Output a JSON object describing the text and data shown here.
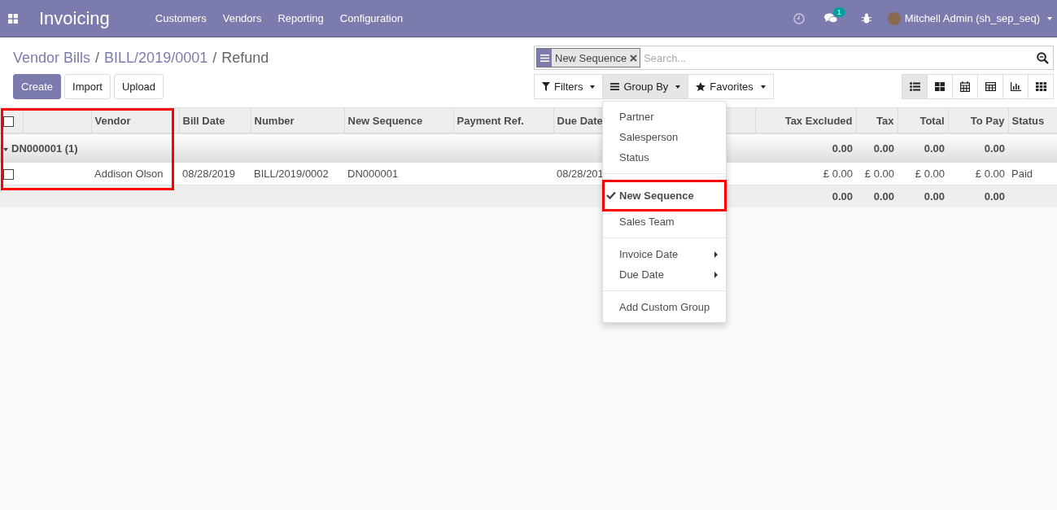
{
  "navbar": {
    "app_title": "Invoicing",
    "menu": [
      "Customers",
      "Vendors",
      "Reporting",
      "Configuration"
    ],
    "chat_badge": "1",
    "user": "Mitchell Admin (sh_sep_seq)"
  },
  "breadcrumb": [
    {
      "label": "Vendor Bills",
      "kind": "link"
    },
    {
      "separator": "/",
      "label": "BILL/2019/0001",
      "kind": "link"
    },
    {
      "separator": "/",
      "label": "Refund",
      "kind": "current"
    }
  ],
  "buttons": [
    {
      "label": "Create",
      "kind": "primary"
    },
    {
      "label": "Import",
      "kind": "default"
    },
    {
      "label": "Upload",
      "kind": "default"
    }
  ],
  "search": {
    "facet": "New Sequence",
    "placeholder": "Search..."
  },
  "search_buttons": [
    {
      "label": "Filters",
      "kind": "filter",
      "expanded": false
    },
    {
      "label": "Group By",
      "kind": "groupby",
      "expanded": true
    },
    {
      "label": "Favorites",
      "kind": "star",
      "expanded": false
    }
  ],
  "views": [
    {
      "kind": "list",
      "selected": true
    },
    {
      "kind": "kanban",
      "selected": false
    },
    {
      "kind": "calendar",
      "selected": false
    },
    {
      "kind": "pivot",
      "selected": false
    },
    {
      "kind": "graph",
      "selected": false
    },
    {
      "kind": "grid",
      "selected": false
    }
  ],
  "groupby_menu": [
    [
      {
        "label": "Partner",
        "kind": "option",
        "selected": false,
        "highlighted": false
      },
      {
        "label": "Salesperson",
        "kind": "option",
        "selected": false,
        "highlighted": false
      },
      {
        "label": "Status",
        "kind": "option",
        "selected": false,
        "highlighted": false
      }
    ],
    [
      {
        "label": "New Sequence",
        "kind": "option",
        "selected": true,
        "highlighted": true
      },
      {
        "label": "Sales Team",
        "kind": "option",
        "selected": false,
        "highlighted": false
      }
    ],
    [
      {
        "label": "Invoice Date",
        "kind": "submenu",
        "selected": false,
        "highlighted": false
      },
      {
        "label": "Due Date",
        "kind": "submenu",
        "selected": false,
        "highlighted": false
      }
    ],
    [
      {
        "label": "Add Custom Group",
        "kind": "option",
        "selected": false,
        "highlighted": false
      }
    ]
  ],
  "table": {
    "select_all_checked": false,
    "columns": [
      {
        "kind": "blank"
      },
      {
        "kind": "text",
        "label": "Vendor"
      },
      {
        "kind": "text",
        "label": "Bill Date"
      },
      {
        "kind": "text",
        "label": "Number"
      },
      {
        "kind": "text",
        "label": "New Sequence"
      },
      {
        "kind": "text",
        "label": "Payment Ref."
      },
      {
        "kind": "text",
        "label": "Due Date"
      },
      {
        "kind": "blank"
      },
      {
        "kind": "number",
        "label": "Tax Excluded"
      },
      {
        "kind": "number",
        "label": "Tax"
      },
      {
        "kind": "number",
        "label": "Total"
      },
      {
        "kind": "number",
        "label": "To Pay"
      },
      {
        "kind": "text",
        "label": "Status"
      }
    ],
    "groups": [
      {
        "label": "DN000001 (1)",
        "expanded": true,
        "totals": [
          "0.00",
          "0.00",
          "0.00",
          "0.00"
        ],
        "rows": [
          {
            "checked": false,
            "cells": [
              {},
              {
                "text": "Addison Olson"
              },
              {
                "text": "08/28/2019"
              },
              {
                "text": "BILL/2019/0002"
              },
              {
                "text": "DN000001"
              },
              {},
              {
                "text": "08/28/201"
              },
              {},
              {
                "text": "£ 0.00"
              },
              {
                "text": "£ 0.00"
              },
              {
                "text": "£ 0.00"
              },
              {
                "text": "£ 0.00"
              },
              {
                "text": "Paid"
              }
            ]
          }
        ]
      }
    ],
    "totals": [
      "0.00",
      "0.00",
      "0.00",
      "0.00"
    ]
  }
}
